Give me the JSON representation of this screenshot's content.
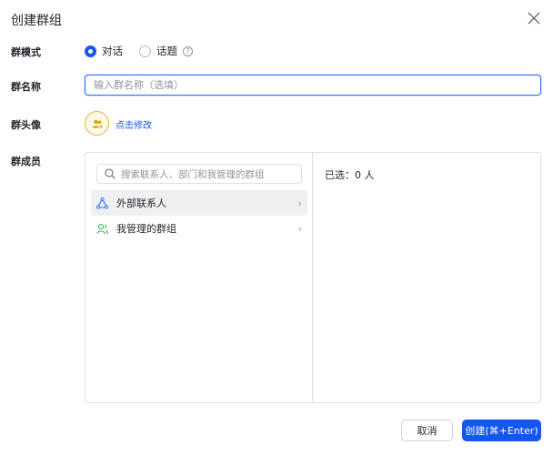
{
  "dialog": {
    "title": "创建群组"
  },
  "mode": {
    "label": "群模式",
    "options": [
      "对话",
      "话题"
    ],
    "selected": "对话"
  },
  "name": {
    "label": "群名称",
    "placeholder": "输入群名称（选填）",
    "value": ""
  },
  "avatar": {
    "label": "群头像",
    "edit_link": "点击修改"
  },
  "members": {
    "label": "群成员",
    "search_placeholder": "搜索联系人、部门和我管理的群组",
    "items": [
      {
        "label": "外部联系人",
        "icon": "external-contacts-icon"
      },
      {
        "label": "我管理的群组",
        "icon": "my-groups-icon"
      }
    ],
    "selected_text": "已选：0 人"
  },
  "footer": {
    "cancel": "取消",
    "create": "创建(⌘+Enter)"
  },
  "colors": {
    "accent": "#1456f0",
    "avatar": "#e0a200"
  }
}
